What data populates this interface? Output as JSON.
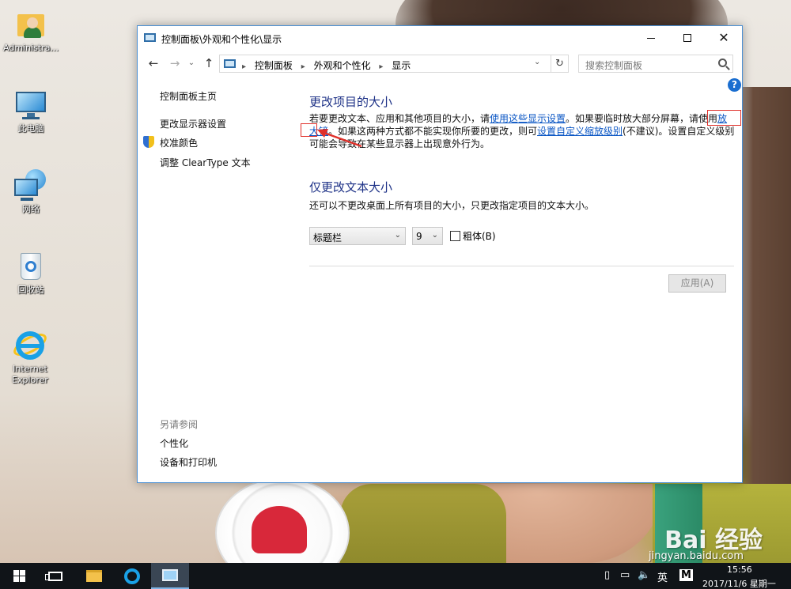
{
  "desktop": {
    "icons": [
      {
        "label": "Administra..."
      },
      {
        "label": "此电脑"
      },
      {
        "label": "网络"
      },
      {
        "label": "回收站"
      },
      {
        "label": "Internet Explorer"
      }
    ],
    "watermark": "Bai 经验",
    "watermark_url": "jingyan.baidu.com"
  },
  "window": {
    "title": "控制面板\\外观和个性化\\显示",
    "breadcrumbs": [
      "控制面板",
      "外观和个性化",
      "显示"
    ],
    "search_placeholder": "搜索控制面板",
    "help_glyph": "?"
  },
  "left_nav": {
    "items": [
      "控制面板主页",
      "更改显示器设置",
      "校准颜色",
      "调整 ClearType 文本"
    ],
    "see_also_title": "另请参阅",
    "see_also": [
      "个性化",
      "设备和打印机"
    ]
  },
  "main": {
    "heading1": "更改项目的大小",
    "para1_a": "若要更改文本、应用和其他项目的大小，请",
    "para1_link1": "使用这些显示设置",
    "para1_b": "。如果要临时放大部分屏幕，请使用",
    "para1_link2": "放大镜",
    "para1_c": "。如果这两种方式都不能实现你所要的更改，则可",
    "para1_link3": "设置自定义缩放级别",
    "para1_d": "(不建议)。设置自定义级别可能会导致在某些显示器上出现意外行为。",
    "heading2": "仅更改文本大小",
    "para2": "还可以不更改桌面上所有项目的大小，只更改指定项目的文本大小。",
    "item_select": "标题栏",
    "size_select": "9",
    "bold_label": "粗体(B)",
    "bold_checked": false,
    "apply_label": "应用(A)"
  },
  "taskbar": {
    "tray_ime": "英",
    "tray_ime2": "M",
    "time": "15:56",
    "date": "2017/11/6 星期一"
  },
  "colors": {
    "heading": "#1e3287",
    "link": "#0a56c4",
    "annotation": "#e0302a",
    "taskbar": "#101418"
  }
}
